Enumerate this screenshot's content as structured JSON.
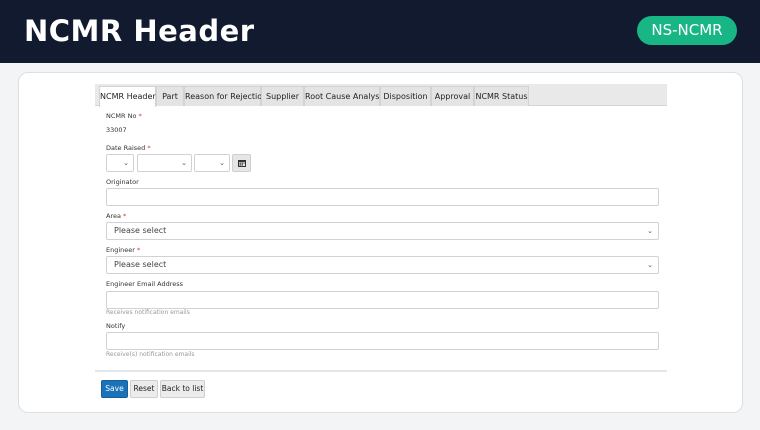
{
  "header": {
    "title": "NCMR Header",
    "badge": "NS-NCMR"
  },
  "tabs": [
    {
      "label": "NCMR Header",
      "active": true
    },
    {
      "label": "Part"
    },
    {
      "label": "Reason for Rejection"
    },
    {
      "label": "Supplier"
    },
    {
      "label": "Root Cause Analysis"
    },
    {
      "label": "Disposition"
    },
    {
      "label": "Approval"
    },
    {
      "label": "NCMR Status"
    }
  ],
  "form": {
    "ncmr_no": {
      "label": "NCMR No",
      "required": "*",
      "value": "33007"
    },
    "date_raised": {
      "label": "Date Raised",
      "required": "*"
    },
    "originator": {
      "label": "Originator",
      "value": ""
    },
    "area": {
      "label": "Area",
      "required": "*",
      "selected": "Please select"
    },
    "engineer": {
      "label": "Engineer",
      "required": "*",
      "selected": "Please select"
    },
    "engineer_email": {
      "label": "Engineer Email Address",
      "value": "",
      "hint": "Receives notification emails"
    },
    "notify": {
      "label": "Notify",
      "value": "",
      "hint": "Receive(s) notification emails"
    }
  },
  "actions": {
    "save": "Save",
    "reset": "Reset",
    "back": "Back to list"
  },
  "colors": {
    "topbar": "#111a2e",
    "badge": "#18b585",
    "primary": "#1a72b8",
    "required": "#dd3333"
  },
  "icons": {
    "calendar": "calendar-icon",
    "chevron": "chevron-down-icon"
  }
}
